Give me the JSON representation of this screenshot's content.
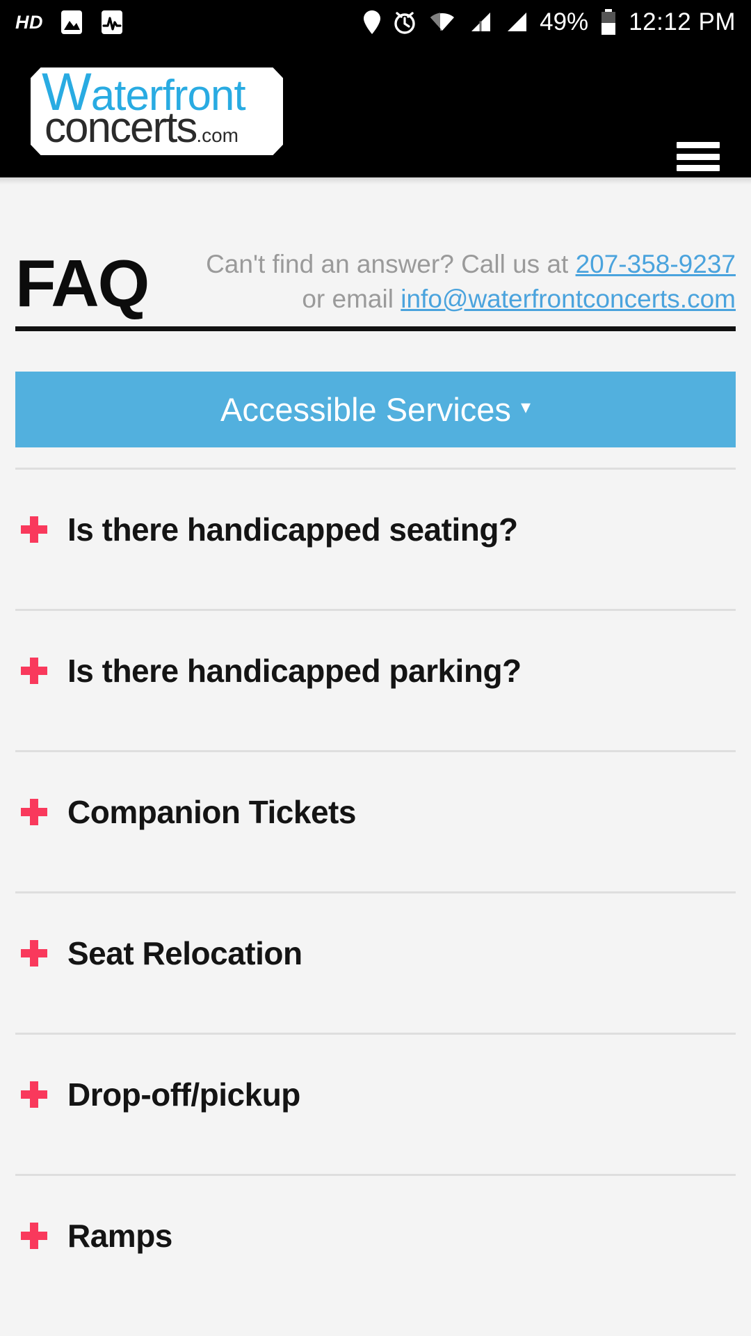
{
  "statusbar": {
    "hd_badge": "HD",
    "icons_left": [
      "hd-badge",
      "image-icon",
      "activity-icon"
    ],
    "icons_right": [
      "location-pin-icon",
      "alarm-clock-icon",
      "wifi-icon",
      "signal-bars-icon",
      "signal-bars-icon"
    ],
    "battery_percent": "49%",
    "time": "12:12 PM"
  },
  "header": {
    "logo_line1": "Waterfront",
    "logo_line1_initial": "W",
    "logo_line1_rest": "aterfront",
    "logo_line2": "concerts",
    "logo_line2_suffix": ".com",
    "menu_icon": "hamburger-menu-icon"
  },
  "faq": {
    "title": "FAQ",
    "contact_prefix": "Can't find an answer? Call us at ",
    "phone": "207-358-9237",
    "contact_middle": " or email ",
    "email": "info@waterfrontconcerts.com",
    "category": {
      "label": "Accessible Services",
      "caret": "▾",
      "expanded": true,
      "bar_color": "#52b0de"
    },
    "items": [
      {
        "question": "Is there handicapped seating?",
        "icon": "plus-icon",
        "expanded": false
      },
      {
        "question": "Is there handicapped parking?",
        "icon": "plus-icon",
        "expanded": false
      },
      {
        "question": "Companion Tickets",
        "icon": "plus-icon",
        "expanded": false
      },
      {
        "question": "Seat Relocation",
        "icon": "plus-icon",
        "expanded": false
      },
      {
        "question": "Drop-off/pickup",
        "icon": "plus-icon",
        "expanded": false
      },
      {
        "question": "Ramps",
        "icon": "plus-icon",
        "expanded": false
      }
    ]
  },
  "colors": {
    "accent_blue": "#52b0de",
    "link_blue": "#4aa3dd",
    "plus_red": "#f9395c",
    "logo_cyan": "#29abe2",
    "page_bg": "#f4f4f4",
    "header_bg": "#000000"
  }
}
